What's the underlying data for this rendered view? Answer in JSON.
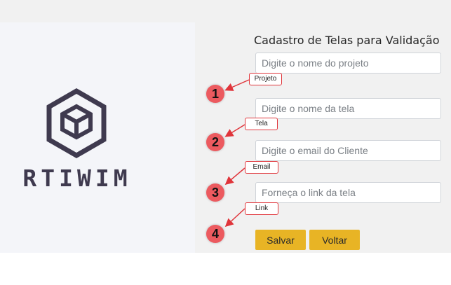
{
  "brand": {
    "logo_text": "RTIWIM"
  },
  "form": {
    "title": "Cadastro de Telas para Validação",
    "fields": [
      {
        "placeholder": "Digite o nome do projeto",
        "tag": "Projeto",
        "number": "1"
      },
      {
        "placeholder": "Digite o nome da tela",
        "tag": "Tela",
        "number": "2"
      },
      {
        "placeholder": "Digite o email do Cliente",
        "tag": "Email",
        "number": "3"
      },
      {
        "placeholder": "Forneça o link da tela",
        "tag": "Link",
        "number": "4"
      }
    ],
    "buttons": {
      "save": "Salvar",
      "back": "Voltar"
    }
  },
  "colors": {
    "button": "#e8b425",
    "annotation": "#e0353b",
    "number_badge": "#ec5a5f",
    "logo": "#3f3a4f"
  }
}
